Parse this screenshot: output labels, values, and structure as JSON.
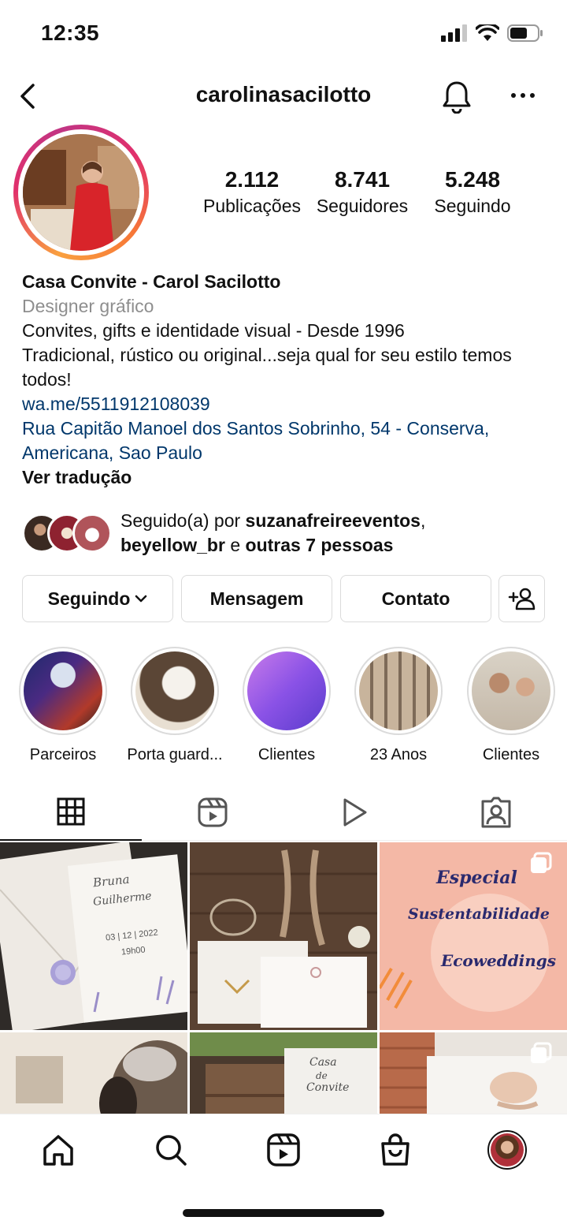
{
  "status_bar": {
    "time": "12:35"
  },
  "header": {
    "username": "carolinasacilotto"
  },
  "stats": [
    {
      "value": "2.112",
      "label": "Publicações"
    },
    {
      "value": "8.741",
      "label": "Seguidores"
    },
    {
      "value": "5.248",
      "label": "Seguindo"
    }
  ],
  "bio": {
    "name": "Casa Convite - Carol Sacilotto",
    "category": "Designer gráfico",
    "line1": "Convites, gifts e identidade visual - Desde 1996",
    "line2": "Tradicional, rústico ou original...seja qual for seu estilo temos todos!",
    "link": "wa.me/5511912108039",
    "address": "Rua Capitão Manoel dos Santos Sobrinho, 54 - Conserva, Americana, Sao Paulo",
    "translate": "Ver tradução"
  },
  "followed_by": {
    "prefix": "Seguido(a) por ",
    "user1": "suzanafreireeventos",
    "sep": ",",
    "user2": "beyellow_br",
    "mid": " e ",
    "others": "outras 7 pessoas"
  },
  "actions": {
    "following": "Seguindo",
    "message": "Mensagem",
    "contact": "Contato"
  },
  "highlights": [
    {
      "label": "Parceiros"
    },
    {
      "label": "Porta guard..."
    },
    {
      "label": "Clientes"
    },
    {
      "label": "23 Anos"
    },
    {
      "label": "Clientes"
    }
  ],
  "posts": {
    "post1": {
      "line1": "Bruna",
      "line2": "Guilherme",
      "date": "03 | 12 | 2022",
      "hour": "19h00"
    },
    "post3": {
      "line1": "Especial",
      "line2": "Sustentabilidade",
      "line3": "Ecoweddings"
    },
    "post5": {
      "line1": "Casa",
      "line2": "de",
      "line3": "Convite"
    }
  },
  "colors": {
    "link": "#00376b",
    "muted": "#8e8e8e",
    "border": "#dbdbdb",
    "post3_bg": "#f4b8a6",
    "post3_text": "#2a2a6e"
  }
}
